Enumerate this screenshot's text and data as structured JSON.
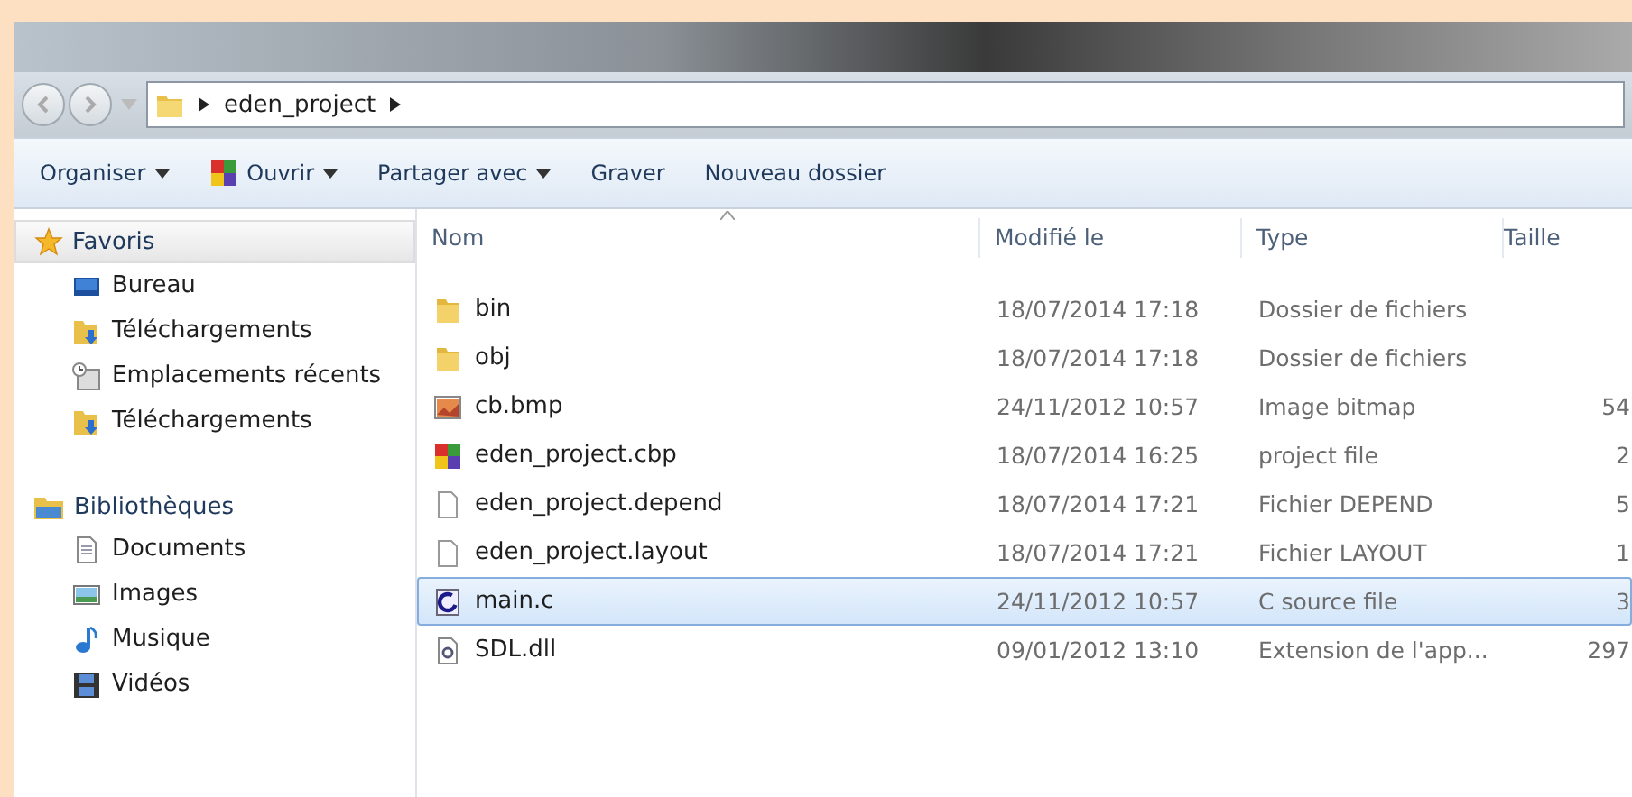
{
  "address_bar": {
    "crumbs": [
      "eden_project"
    ]
  },
  "toolbar": [
    {
      "label": "Organiser",
      "kind": "menu"
    },
    {
      "label": "Ouvrir",
      "kind": "open"
    },
    {
      "label": "Partager avec",
      "kind": "menu"
    },
    {
      "label": "Graver",
      "kind": "plain"
    },
    {
      "label": "Nouveau dossier",
      "kind": "plain"
    }
  ],
  "sidebar": {
    "groups": [
      {
        "label": "Favoris",
        "kind": "star",
        "selected": true,
        "items": [
          {
            "label": "Bureau",
            "kind": "desktop"
          },
          {
            "label": "Téléchargements",
            "kind": "download"
          },
          {
            "label": "Emplacements récents",
            "kind": "recent"
          },
          {
            "label": "Téléchargements",
            "kind": "download"
          }
        ]
      },
      {
        "label": "Bibliothèques",
        "kind": "library",
        "selected": false,
        "items": [
          {
            "label": "Documents",
            "kind": "document"
          },
          {
            "label": "Images",
            "kind": "image"
          },
          {
            "label": "Musique",
            "kind": "music"
          },
          {
            "label": "Vidéos",
            "kind": "video"
          }
        ]
      }
    ]
  },
  "table": {
    "columns": [
      "Nom",
      "Modifié le",
      "Type",
      "Taille"
    ],
    "rows": [
      {
        "name": "bin",
        "modified": "18/07/2014 17:18",
        "type": "Dossier de fichiers",
        "size": "",
        "kind": "folder",
        "selected": false
      },
      {
        "name": "obj",
        "modified": "18/07/2014 17:18",
        "type": "Dossier de fichiers",
        "size": "",
        "kind": "folder",
        "selected": false
      },
      {
        "name": "cb.bmp",
        "modified": "24/11/2012 10:57",
        "type": "Image bitmap",
        "size": "54",
        "kind": "bitmap",
        "selected": false
      },
      {
        "name": "eden_project.cbp",
        "modified": "18/07/2014 16:25",
        "type": "project file",
        "size": "2",
        "kind": "project",
        "selected": false
      },
      {
        "name": "eden_project.depend",
        "modified": "18/07/2014 17:21",
        "type": "Fichier DEPEND",
        "size": "5",
        "kind": "file",
        "selected": false
      },
      {
        "name": "eden_project.layout",
        "modified": "18/07/2014 17:21",
        "type": "Fichier LAYOUT",
        "size": "1",
        "kind": "file",
        "selected": false
      },
      {
        "name": "main.c",
        "modified": "24/11/2012 10:57",
        "type": "C source file",
        "size": "3",
        "kind": "csource",
        "selected": true
      },
      {
        "name": "SDL.dll",
        "modified": "09/01/2012 13:10",
        "type": "Extension de l'app...",
        "size": "297",
        "kind": "dll",
        "selected": false
      }
    ]
  }
}
